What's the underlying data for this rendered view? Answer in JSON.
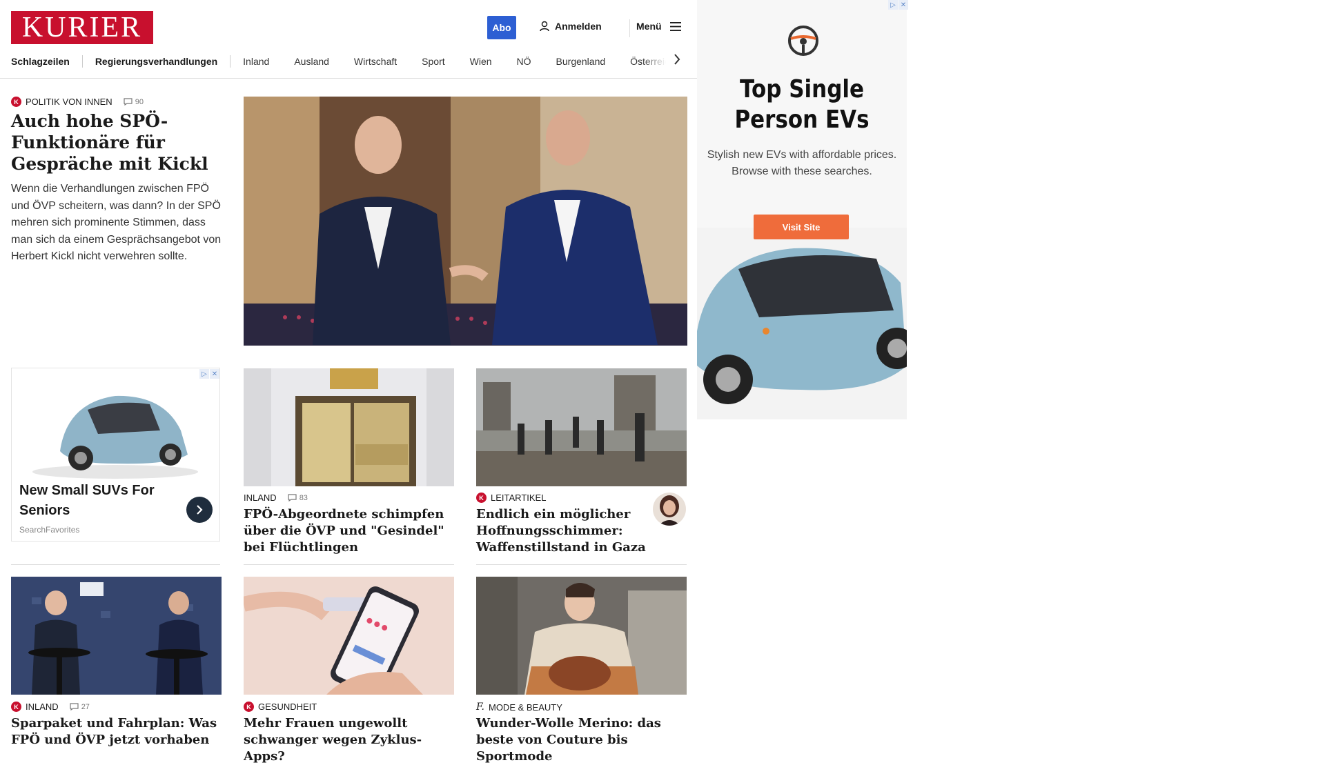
{
  "header": {
    "logo": "KURIER",
    "abo_label": "Abo",
    "login_label": "Anmelden",
    "menu_label": "Menü"
  },
  "nav": {
    "items": [
      "Schlagzeilen",
      "Regierungsverhandlungen",
      "Inland",
      "Ausland",
      "Wirtschaft",
      "Sport",
      "Wien",
      "NÖ",
      "Burgenland",
      "Österreich"
    ]
  },
  "lead": {
    "kicker": "POLITIK VON INNEN",
    "comments": "90",
    "title": "Auch hohe SPÖ-Funktio­näre für Gespräche mit Kickl",
    "teaser": "Wenn die Verhandlungen zwischen FPÖ und ÖVP scheitern, was dann? In der SPÖ mehren sich prominente Stimmen, dass man sich da einem Gesprächsangebot von Herbert Kickl nicht verwehren sollte."
  },
  "ad_card": {
    "title": "New Small SUVs For Seniors",
    "source": "SearchFavorites"
  },
  "side_ad": {
    "title": "Top Single Person EVs",
    "subtitle": "Stylish new EVs with affordable prices. Browse with these searches.",
    "button": "Visit Site"
  },
  "stories": [
    {
      "kicker": "INLAND",
      "comments": "83",
      "title": "FPÖ-Abgeordnete schimpfen über die ÖVP und \"Gesindel\" bei Flüchtlingen"
    },
    {
      "kicker": "LEITARTIKEL",
      "title": "Endlich ein möglicher Hoffnungsschimmer: Waf­fenstillstand in Gaza"
    },
    {
      "kicker": "INLAND",
      "comments": "27",
      "title": "Sparpaket und Fahrplan: Was FPÖ und ÖVP jetzt vorhaben"
    },
    {
      "kicker": "GESUNDHEIT",
      "title": "Mehr Frauen ungewollt schwanger wegen Zyklus-Apps?"
    },
    {
      "kicker": "MODE & BEAUTY",
      "title": "Wunder-Wolle Merino: das beste von Couture bis Sportmode"
    }
  ],
  "colors": {
    "brand": "#c8102e",
    "accent": "#2d5fd3",
    "ad_button": "#ef6c3b"
  }
}
